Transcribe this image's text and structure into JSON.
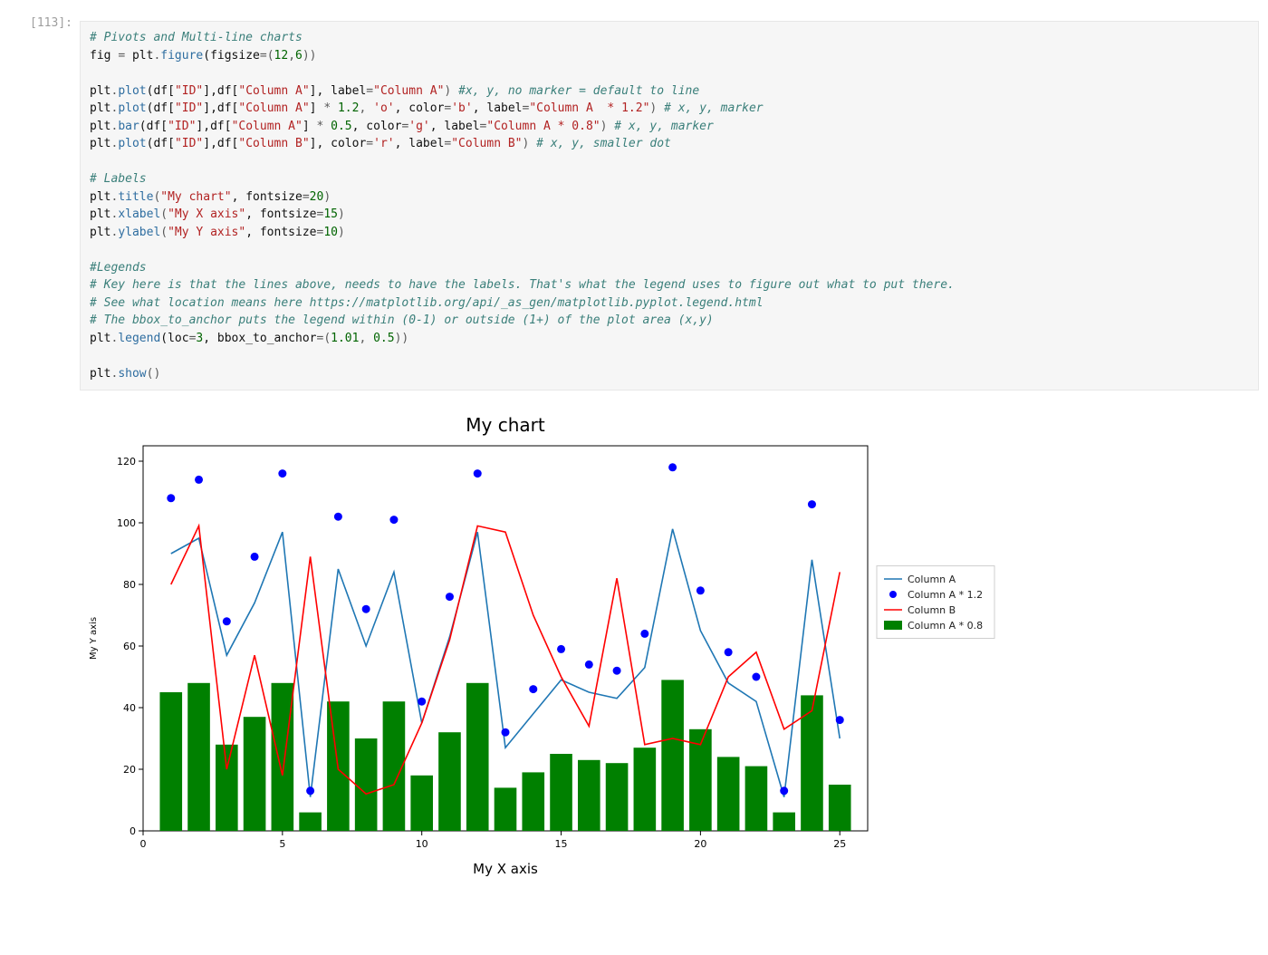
{
  "cell": {
    "prompt": "[113]:",
    "code_lines": [
      [
        {
          "t": "# Pivots and Multi-line charts",
          "c": "c-comment"
        }
      ],
      [
        {
          "t": "fig ",
          "c": "c-ident"
        },
        {
          "t": "=",
          "c": "c-assign"
        },
        {
          "t": " plt",
          "c": "c-ident"
        },
        {
          "t": ".",
          "c": "c-op"
        },
        {
          "t": "figure",
          "c": "c-attr"
        },
        {
          "t": "(figsize",
          "c": "c-ident"
        },
        {
          "t": "=",
          "c": "c-assign"
        },
        {
          "t": "(",
          "c": "c-op"
        },
        {
          "t": "12",
          "c": "c-num"
        },
        {
          "t": ",",
          "c": "c-op"
        },
        {
          "t": "6",
          "c": "c-num"
        },
        {
          "t": "))",
          "c": "c-op"
        }
      ],
      [],
      [
        {
          "t": "plt",
          "c": "c-ident"
        },
        {
          "t": ".",
          "c": "c-op"
        },
        {
          "t": "plot",
          "c": "c-attr"
        },
        {
          "t": "(df[",
          "c": "c-ident"
        },
        {
          "t": "\"ID\"",
          "c": "c-str"
        },
        {
          "t": "],df[",
          "c": "c-ident"
        },
        {
          "t": "\"Column A\"",
          "c": "c-str"
        },
        {
          "t": "], label",
          "c": "c-ident"
        },
        {
          "t": "=",
          "c": "c-assign"
        },
        {
          "t": "\"Column A\"",
          "c": "c-str"
        },
        {
          "t": ") ",
          "c": "c-op"
        },
        {
          "t": "#x, y, no marker = default to line",
          "c": "c-comment"
        }
      ],
      [
        {
          "t": "plt",
          "c": "c-ident"
        },
        {
          "t": ".",
          "c": "c-op"
        },
        {
          "t": "plot",
          "c": "c-attr"
        },
        {
          "t": "(df[",
          "c": "c-ident"
        },
        {
          "t": "\"ID\"",
          "c": "c-str"
        },
        {
          "t": "],df[",
          "c": "c-ident"
        },
        {
          "t": "\"Column A\"",
          "c": "c-str"
        },
        {
          "t": "] ",
          "c": "c-ident"
        },
        {
          "t": "*",
          "c": "c-op"
        },
        {
          "t": " ",
          "c": "c-ident"
        },
        {
          "t": "1.2",
          "c": "c-num"
        },
        {
          "t": ", ",
          "c": "c-op"
        },
        {
          "t": "'o'",
          "c": "c-str"
        },
        {
          "t": ", color",
          "c": "c-ident"
        },
        {
          "t": "=",
          "c": "c-assign"
        },
        {
          "t": "'b'",
          "c": "c-str"
        },
        {
          "t": ", label",
          "c": "c-ident"
        },
        {
          "t": "=",
          "c": "c-assign"
        },
        {
          "t": "\"Column A  * 1.2\"",
          "c": "c-str"
        },
        {
          "t": ") ",
          "c": "c-op"
        },
        {
          "t": "# x, y, marker",
          "c": "c-comment"
        }
      ],
      [
        {
          "t": "plt",
          "c": "c-ident"
        },
        {
          "t": ".",
          "c": "c-op"
        },
        {
          "t": "bar",
          "c": "c-attr"
        },
        {
          "t": "(df[",
          "c": "c-ident"
        },
        {
          "t": "\"ID\"",
          "c": "c-str"
        },
        {
          "t": "],df[",
          "c": "c-ident"
        },
        {
          "t": "\"Column A\"",
          "c": "c-str"
        },
        {
          "t": "] ",
          "c": "c-ident"
        },
        {
          "t": "*",
          "c": "c-op"
        },
        {
          "t": " ",
          "c": "c-ident"
        },
        {
          "t": "0.5",
          "c": "c-num"
        },
        {
          "t": ", color",
          "c": "c-ident"
        },
        {
          "t": "=",
          "c": "c-assign"
        },
        {
          "t": "'g'",
          "c": "c-str"
        },
        {
          "t": ", label",
          "c": "c-ident"
        },
        {
          "t": "=",
          "c": "c-assign"
        },
        {
          "t": "\"Column A * 0.8\"",
          "c": "c-str"
        },
        {
          "t": ") ",
          "c": "c-op"
        },
        {
          "t": "# x, y, marker",
          "c": "c-comment"
        }
      ],
      [
        {
          "t": "plt",
          "c": "c-ident"
        },
        {
          "t": ".",
          "c": "c-op"
        },
        {
          "t": "plot",
          "c": "c-attr"
        },
        {
          "t": "(df[",
          "c": "c-ident"
        },
        {
          "t": "\"ID\"",
          "c": "c-str"
        },
        {
          "t": "],df[",
          "c": "c-ident"
        },
        {
          "t": "\"Column B\"",
          "c": "c-str"
        },
        {
          "t": "], color",
          "c": "c-ident"
        },
        {
          "t": "=",
          "c": "c-assign"
        },
        {
          "t": "'r'",
          "c": "c-str"
        },
        {
          "t": ", label",
          "c": "c-ident"
        },
        {
          "t": "=",
          "c": "c-assign"
        },
        {
          "t": "\"Column B\"",
          "c": "c-str"
        },
        {
          "t": ") ",
          "c": "c-op"
        },
        {
          "t": "# x, y, smaller dot",
          "c": "c-comment"
        }
      ],
      [],
      [
        {
          "t": "# Labels",
          "c": "c-comment"
        }
      ],
      [
        {
          "t": "plt",
          "c": "c-ident"
        },
        {
          "t": ".",
          "c": "c-op"
        },
        {
          "t": "title",
          "c": "c-attr"
        },
        {
          "t": "(",
          "c": "c-op"
        },
        {
          "t": "\"My chart\"",
          "c": "c-str"
        },
        {
          "t": ", fontsize",
          "c": "c-ident"
        },
        {
          "t": "=",
          "c": "c-assign"
        },
        {
          "t": "20",
          "c": "c-num"
        },
        {
          "t": ")",
          "c": "c-op"
        }
      ],
      [
        {
          "t": "plt",
          "c": "c-ident"
        },
        {
          "t": ".",
          "c": "c-op"
        },
        {
          "t": "xlabel",
          "c": "c-attr"
        },
        {
          "t": "(",
          "c": "c-op"
        },
        {
          "t": "\"My X axis\"",
          "c": "c-str"
        },
        {
          "t": ", fontsize",
          "c": "c-ident"
        },
        {
          "t": "=",
          "c": "c-assign"
        },
        {
          "t": "15",
          "c": "c-num"
        },
        {
          "t": ")",
          "c": "c-op"
        }
      ],
      [
        {
          "t": "plt",
          "c": "c-ident"
        },
        {
          "t": ".",
          "c": "c-op"
        },
        {
          "t": "ylabel",
          "c": "c-attr"
        },
        {
          "t": "(",
          "c": "c-op"
        },
        {
          "t": "\"My Y axis\"",
          "c": "c-str"
        },
        {
          "t": ", fontsize",
          "c": "c-ident"
        },
        {
          "t": "=",
          "c": "c-assign"
        },
        {
          "t": "10",
          "c": "c-num"
        },
        {
          "t": ")",
          "c": "c-op"
        }
      ],
      [],
      [
        {
          "t": "#Legends",
          "c": "c-comment"
        }
      ],
      [
        {
          "t": "# Key here is that the lines above, needs to have the labels. That's what the legend uses to figure out what to put there.",
          "c": "c-comment"
        }
      ],
      [
        {
          "t": "# See what location means here https://matplotlib.org/api/_as_gen/matplotlib.pyplot.legend.html",
          "c": "c-comment"
        }
      ],
      [
        {
          "t": "# The bbox_to_anchor puts the legend within (0-1) or outside (1+) of the plot area (x,y)",
          "c": "c-comment"
        }
      ],
      [
        {
          "t": "plt",
          "c": "c-ident"
        },
        {
          "t": ".",
          "c": "c-op"
        },
        {
          "t": "legend",
          "c": "c-attr"
        },
        {
          "t": "(loc",
          "c": "c-ident"
        },
        {
          "t": "=",
          "c": "c-assign"
        },
        {
          "t": "3",
          "c": "c-num"
        },
        {
          "t": ", bbox_to_anchor",
          "c": "c-ident"
        },
        {
          "t": "=",
          "c": "c-assign"
        },
        {
          "t": "(",
          "c": "c-op"
        },
        {
          "t": "1.01",
          "c": "c-num"
        },
        {
          "t": ", ",
          "c": "c-op"
        },
        {
          "t": "0.5",
          "c": "c-num"
        },
        {
          "t": "))",
          "c": "c-op"
        }
      ],
      [],
      [
        {
          "t": "plt",
          "c": "c-ident"
        },
        {
          "t": ".",
          "c": "c-op"
        },
        {
          "t": "show",
          "c": "c-attr"
        },
        {
          "t": "()",
          "c": "c-op"
        }
      ]
    ]
  },
  "chart_data": {
    "type": "mixed",
    "title": "My chart",
    "xlabel": "My X axis",
    "ylabel": "My Y axis",
    "xlim": [
      0,
      26
    ],
    "ylim": [
      0,
      125
    ],
    "xticks": [
      0,
      5,
      10,
      15,
      20,
      25
    ],
    "yticks": [
      0,
      20,
      40,
      60,
      80,
      100,
      120
    ],
    "x": [
      1,
      2,
      3,
      4,
      5,
      6,
      7,
      8,
      9,
      10,
      11,
      12,
      13,
      14,
      15,
      16,
      17,
      18,
      19,
      20,
      21,
      22,
      23,
      24,
      25
    ],
    "series": [
      {
        "name": "Column A",
        "type": "line",
        "color": "#1f77b4",
        "values": [
          90,
          95,
          57,
          74,
          97,
          11,
          85,
          60,
          84,
          35,
          63,
          97,
          27,
          38,
          49,
          45,
          43,
          53,
          98,
          65,
          48,
          42,
          11,
          88,
          30
        ]
      },
      {
        "name": "Column A  * 1.2",
        "type": "scatter",
        "color": "#0000ff",
        "values": [
          108,
          114,
          68,
          89,
          116,
          13,
          102,
          72,
          101,
          42,
          76,
          116,
          32,
          46,
          59,
          54,
          52,
          64,
          118,
          78,
          58,
          50,
          13,
          106,
          36
        ]
      },
      {
        "name": "Column B",
        "type": "line",
        "color": "#ff0000",
        "values": [
          80,
          99,
          20,
          57,
          18,
          89,
          20,
          12,
          15,
          35,
          62,
          99,
          97,
          70,
          50,
          34,
          82,
          28,
          30,
          28,
          50,
          58,
          33,
          39,
          84
        ]
      },
      {
        "name": "Column A * 0.8",
        "type": "bar",
        "color": "#008000",
        "values": [
          45,
          48,
          28,
          37,
          48,
          6,
          42,
          30,
          42,
          18,
          32,
          48,
          14,
          19,
          25,
          23,
          22,
          27,
          49,
          33,
          24,
          21,
          6,
          44,
          15
        ]
      }
    ],
    "legend": {
      "position": "outside-right",
      "y_anchor": 0.5
    }
  }
}
